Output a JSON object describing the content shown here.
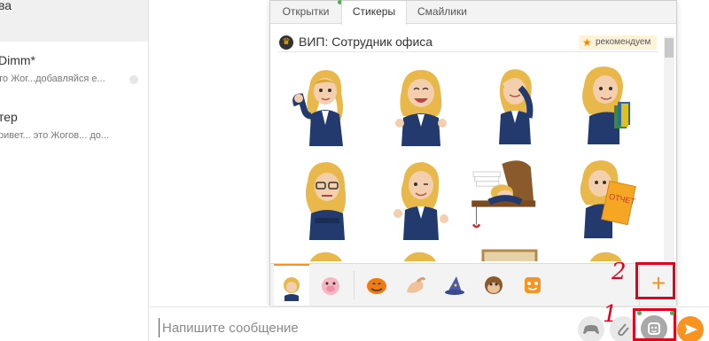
{
  "sidebar": {
    "chats": [
      {
        "name": "ва",
        "preview": ""
      },
      {
        "name": "Dimm*",
        "preview": "то Жог...добавляйся е..."
      },
      {
        "name": "тер",
        "preview": "ривет... это Жогов... до..."
      }
    ]
  },
  "popup": {
    "tabs": [
      {
        "label": "Открытки"
      },
      {
        "label": "Стикеры"
      },
      {
        "label": "Смайлики"
      }
    ],
    "pack_title": "ВИП: Сотрудник офиса",
    "recommend_label": "рекомендуем",
    "sticker_label": "ОТЧЕТ",
    "add_label": "+"
  },
  "annotations": {
    "label_1": "1",
    "label_2": "2",
    "color": "#e3001b"
  },
  "input": {
    "placeholder": "Напишите сообщение"
  },
  "icons": {
    "crown": "crown-icon",
    "star": "star-icon",
    "add": "plus-icon",
    "gamepad": "gamepad-icon",
    "attach": "paperclip-icon",
    "smile": "smile-icon",
    "send": "send-icon"
  },
  "colors": {
    "accent": "#f7931e",
    "annotation": "#e3001b"
  }
}
